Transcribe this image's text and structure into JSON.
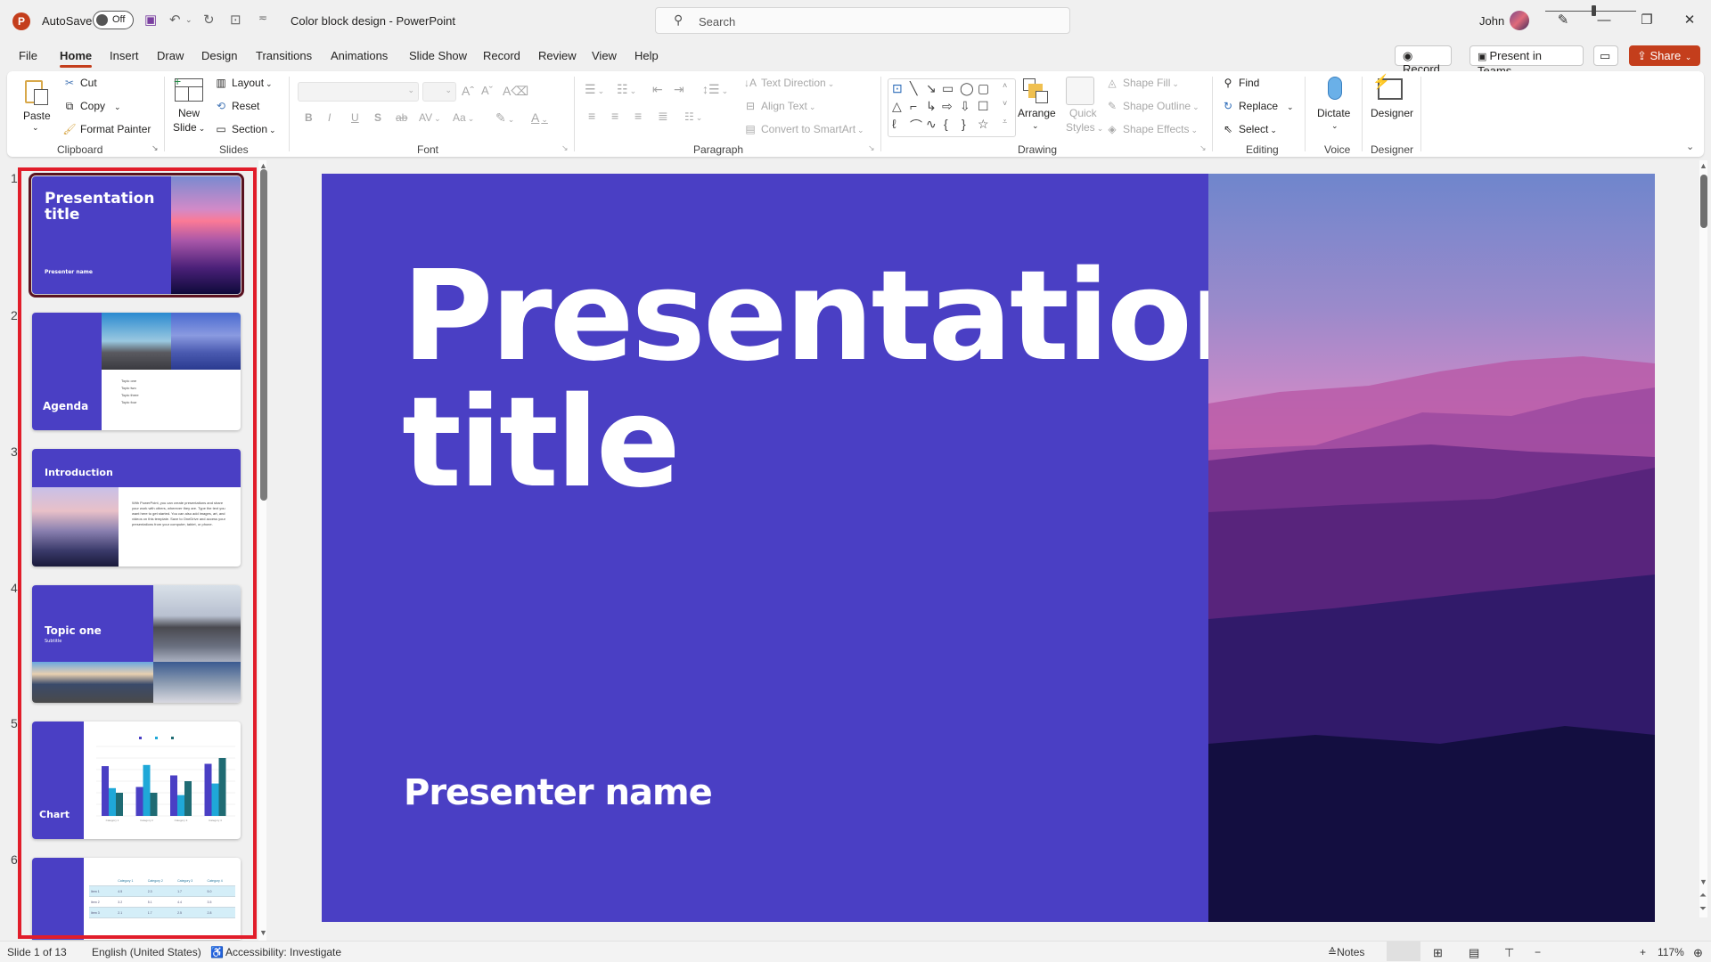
{
  "app": {
    "logo": "P",
    "autosave_label": "AutoSave",
    "autosave_state": "Off",
    "document_title": "Color block design  -  PowerPoint",
    "search_placeholder": "Search",
    "user_name": "John",
    "window_controls": {
      "minimize": "—",
      "restore": "❐",
      "close": "✕"
    }
  },
  "menu": {
    "tabs": [
      "File",
      "Home",
      "Insert",
      "Draw",
      "Design",
      "Transitions",
      "Animations",
      "Slide Show",
      "Record",
      "Review",
      "View",
      "Help"
    ],
    "active_tab": "Home",
    "record_btn": "Record",
    "present_teams_btn": "Present in Teams",
    "share_btn": "Share"
  },
  "ribbon": {
    "clipboard": {
      "paste": "Paste",
      "cut": "Cut",
      "copy": "Copy",
      "format_painter": "Format Painter",
      "label": "Clipboard"
    },
    "slides": {
      "new_slide_1": "New",
      "new_slide_2": "Slide",
      "layout": "Layout",
      "reset": "Reset",
      "section": "Section",
      "label": "Slides"
    },
    "font": {
      "label": "Font",
      "font_name": "",
      "font_size": "",
      "bold": "B",
      "italic": "I",
      "underline": "U",
      "shadow": "S",
      "strike": "ab",
      "spacing": "AV",
      "case": "Aa"
    },
    "paragraph": {
      "label": "Paragraph",
      "text_direction": "Text Direction",
      "align_text": "Align Text",
      "convert_smartart": "Convert to SmartArt"
    },
    "drawing": {
      "label": "Drawing",
      "arrange": "Arrange",
      "quick_styles_1": "Quick",
      "quick_styles_2": "Styles",
      "shape_fill": "Shape Fill",
      "shape_outline": "Shape Outline",
      "shape_effects": "Shape Effects"
    },
    "editing": {
      "label": "Editing",
      "find": "Find",
      "replace": "Replace",
      "select": "Select"
    },
    "voice": {
      "label": "Voice",
      "dictate": "Dictate"
    },
    "designer": {
      "label": "Designer",
      "designer": "Designer"
    }
  },
  "thumbnails": [
    {
      "num": "1",
      "title": "Presentation title",
      "subtitle": "Presenter name",
      "selected": true
    },
    {
      "num": "2",
      "title": "Agenda",
      "bullets": [
        "Topic one",
        "Topic two",
        "Topic three",
        "Topic four"
      ]
    },
    {
      "num": "3",
      "title": "Introduction",
      "body": "With PowerPoint, you can create presentations and share your work with others, wherever they are. Type the text you want here to get started. You can also add images, art, and videos on this template. Save to OneDrive and access your presentations from your computer, tablet, or phone."
    },
    {
      "num": "4",
      "title": "Topic one",
      "subtitle": "Subtitle"
    },
    {
      "num": "5",
      "title": "Chart",
      "chart": {
        "series_colors": [
          "#4a3fc4",
          "#1fa8d8",
          "#1f6b73"
        ],
        "values": [
          [
            4.3,
            2.4,
            2.0
          ],
          [
            2.5,
            4.4,
            2.0
          ],
          [
            3.5,
            1.8,
            3.0
          ],
          [
            4.5,
            2.8,
            5.0
          ]
        ],
        "categories": [
          "Category 1",
          "Category 2",
          "Category 3",
          "Category 4"
        ]
      }
    },
    {
      "num": "6",
      "table": {
        "headers": [
          "",
          "Category 1",
          "Category 2",
          "Category 3",
          "Category 4"
        ],
        "rows": [
          [
            "Item 1",
            "4.5",
            "2.3",
            "1.7",
            "5.0"
          ],
          [
            "Item 2",
            "3.2",
            "5.1",
            "4.4",
            "3.5"
          ],
          [
            "Item 3",
            "2.1",
            "1.7",
            "2.5",
            "2.8"
          ]
        ]
      }
    }
  ],
  "slide": {
    "title_line1": "Presentation",
    "title_line2": "title",
    "presenter": "Presenter name",
    "bg_color": "#4a3fc4"
  },
  "status": {
    "slide_counter": "Slide 1 of 13",
    "language": "English (United States)",
    "accessibility": "Accessibility: Investigate",
    "notes": "Notes",
    "zoom_level": "117%",
    "zoom_minus": "−",
    "zoom_plus": "+"
  }
}
